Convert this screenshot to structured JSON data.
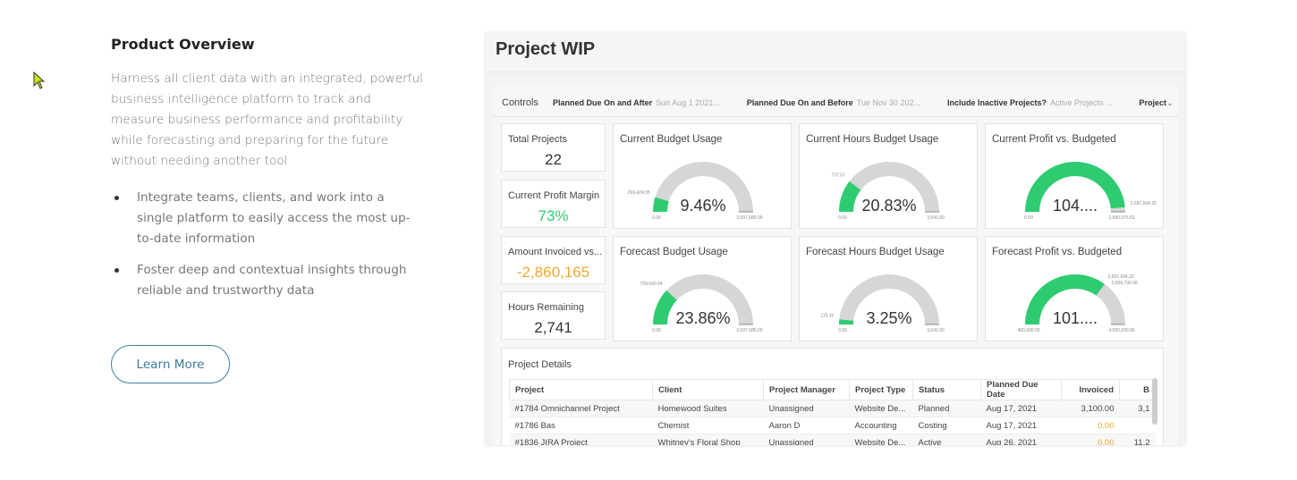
{
  "overview": {
    "title": "Product Overview",
    "description": "Harness all client data with an integrated, powerful business intelligence platform to track and measure business performance and profitability while forecasting and preparing for the future without needing another tool",
    "bullets": [
      "Integrate teams, clients, and work into a single platform to easily access the most up-to-date information",
      "Foster deep and contextual insights through reliable and trustworthy data"
    ],
    "learn_more": "Learn More"
  },
  "dashboard": {
    "title": "Project WIP",
    "controls": {
      "label": "Controls",
      "filters": [
        {
          "name": "Planned Due On and After",
          "value": "Sun Aug 1 2021..."
        },
        {
          "name": "Planned Due On and Before",
          "value": "Tue Nov 30 202..."
        },
        {
          "name": "Include Inactive Projects?",
          "value": "Active Projects ..."
        }
      ],
      "project": "Project"
    },
    "kpis": [
      {
        "label": "Total Projects",
        "value": "22",
        "color": "#333333"
      },
      {
        "label": "Current Profit Margin",
        "value": "73%",
        "color": "#2ecc71"
      },
      {
        "label": "Amount Invoiced vs...",
        "value": "-2,860,165",
        "color": "#f0a830"
      },
      {
        "label": "Hours Remaining",
        "value": "2,741",
        "color": "#333333"
      }
    ],
    "gauges": [
      {
        "title": "Current Budget Usage",
        "display": "9.46%",
        "fraction": 0.0946,
        "min": "0.00",
        "max": "3,597,685.00",
        "marker": "269,424.05"
      },
      {
        "title": "Current Hours Budget Usage",
        "display": "20.83%",
        "fraction": 0.2083,
        "min": "0.00",
        "max": "3,541.00",
        "marker": "737.57"
      },
      {
        "title": "Current Profit vs. Budgeted",
        "display": "104....",
        "fraction": 0.97,
        "min": "0.00",
        "max": "2,580,975.52",
        "marker": "2,697,694.25"
      },
      {
        "title": "Forecast Budget Usage",
        "display": "23.86%",
        "fraction": 0.2386,
        "min": "0.00",
        "max": "3,597,685.00",
        "marker": "729,690.94"
      },
      {
        "title": "Forecast Hours Budget Usage",
        "display": "3.25%",
        "fraction": 0.0325,
        "min": "0.00",
        "max": "3,541.00",
        "marker": "115.10"
      },
      {
        "title": "Forecast Profit vs. Budgeted",
        "display": "101....",
        "fraction": 0.7,
        "min": "400,000.00",
        "max": "4,000,000.00",
        "marker": "2,697,694.23",
        "marker2": "2,694,730.68"
      }
    ],
    "gauge_colors": {
      "fill": "#2ecc71",
      "track": "#d6d6d6"
    },
    "details": {
      "title": "Project Details",
      "columns": [
        "Project",
        "Client",
        "Project Manager",
        "Project Type",
        "Status",
        "Planned Due Date",
        "Invoiced",
        "B"
      ],
      "rows": [
        [
          "#1784 Omnichannel Project",
          "Homewood Suites",
          "Unassigned",
          "Website De...",
          "Planned",
          "Aug 17, 2021",
          "3,100.00",
          "3,1"
        ],
        [
          "#1786 Bas",
          "Chemist",
          "Aaron D",
          "Accounting",
          "Costing",
          "Aug 17, 2021",
          "0.00",
          ""
        ],
        [
          "#1836 JIRA Project",
          "Whitney's Floral Shop",
          "Unassigned",
          "Website De...",
          "Active",
          "Aug 26, 2021",
          "0.00",
          "11,2"
        ]
      ]
    }
  }
}
